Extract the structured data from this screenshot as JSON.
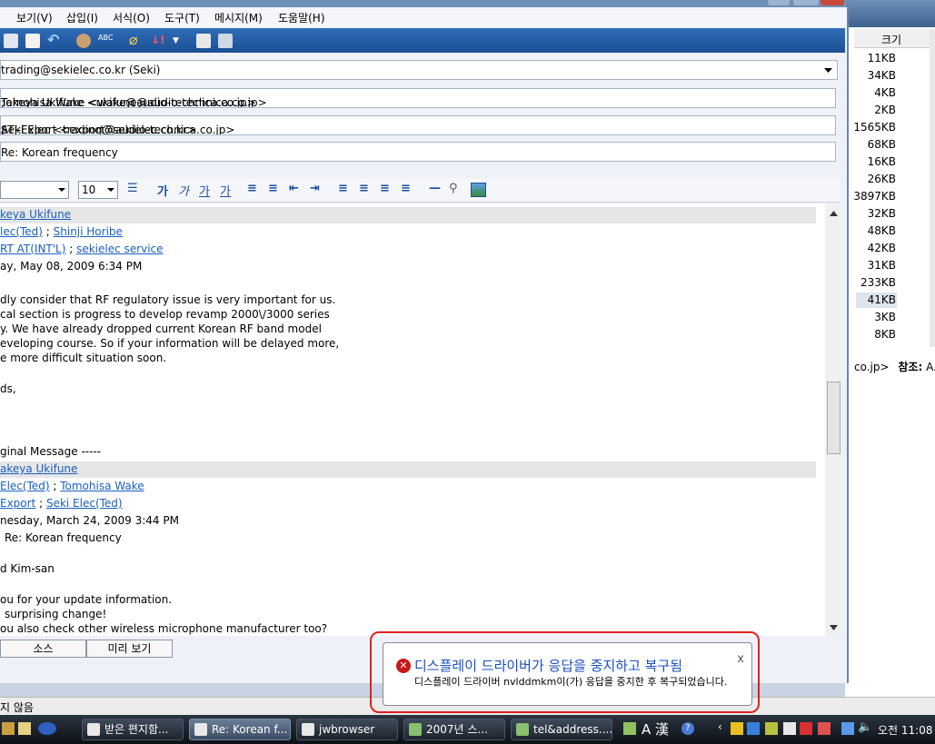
{
  "menu": [
    "보기(V)",
    "삽입(I)",
    "서식(O)",
    "도구(T)",
    "메시지(M)",
    "도움말(H)"
  ],
  "compose": {
    "from": "trading@sekielec.co.kr   (Seki)",
    "to_1": "Takeya Ukifune <ukifune@audio-technica.co.jp>",
    "to_2": "Tomohisa Wake <wake@audio-technica.co.jp>",
    "cc_1": "ATJ-Export <export@audio-technica.co.jp>",
    "cc_2": "Seki Elec <trading@sekielec.co.kr>",
    "separator": ";",
    "subject": "Re: Korean frequency"
  },
  "format": {
    "font_size": "10",
    "buttons": [
      "가",
      "가",
      "가",
      "가"
    ]
  },
  "body": {
    "header_from": "keya Ukifune",
    "header_to_1": "lec(Ted)",
    "header_to_2": "Shinji Horibe",
    "header_cc_1": "RT AT(INT'L)",
    "header_cc_2": "sekielec service",
    "header_date": "ay, May 08, 2009 6:34 PM",
    "p1": [
      "dly consider that RF regulatory issue is very important for us.",
      "cal section is progress to develop revamp 2000\\/3000 series",
      "y. We have already dropped current Korean RF band model",
      "eveloping course. So if your information will be delayed more,",
      "e more difficult situation soon."
    ],
    "regards": "ds,",
    "orig": "ginal Message -----",
    "q_from": "akeya Ukifune",
    "q_to_1": "Elec(Ted)",
    "q_to_2": "Tomohisa Wake",
    "q_cc_1": "Export",
    "q_cc_2": "Seki Elec(Ted)",
    "q_date": "nesday, March 24, 2009 3:44 PM",
    "q_subject": "Re: Korean frequency",
    "q_greet": "d Kim-san",
    "q_body": [
      "ou for your update information.",
      "surprising change!",
      "ou also check other wireless microphone manufacturer too?"
    ]
  },
  "tabs": [
    "소스",
    "미리 보기"
  ],
  "bgwindow": {
    "col_size": "크기",
    "sizes": [
      "11KB",
      "34KB",
      "4KB",
      "2KB",
      "1565KB",
      "68KB",
      "16KB",
      "26KB",
      "3897KB",
      "32KB",
      "48KB",
      "42KB",
      "31KB",
      "233KB",
      "41KB",
      "3KB",
      "8KB"
    ],
    "cc_text": "co.jp>",
    "cc_label": "참조:",
    "cc_more": "A..."
  },
  "statusbar": {
    "left": "지 않음"
  },
  "taskbar": {
    "tasks": [
      "받은 편지함...",
      "Re: Korean f...",
      "jwbrowser",
      "2007년 스...",
      "tel&address...."
    ],
    "ime": "A 漢",
    "clock": "오전 11:08"
  },
  "balloon": {
    "title": "디스플레이 드라이버가 응답을 중지하고 복구됨",
    "message": "디스플레이 드라이버 nvlddmkm이(가) 응답을 중지한 후 복구되었습니다.",
    "close": "x"
  },
  "colors": {
    "accent": "#1d4f93",
    "link": "#1a5fbf",
    "error": "#c81818"
  }
}
